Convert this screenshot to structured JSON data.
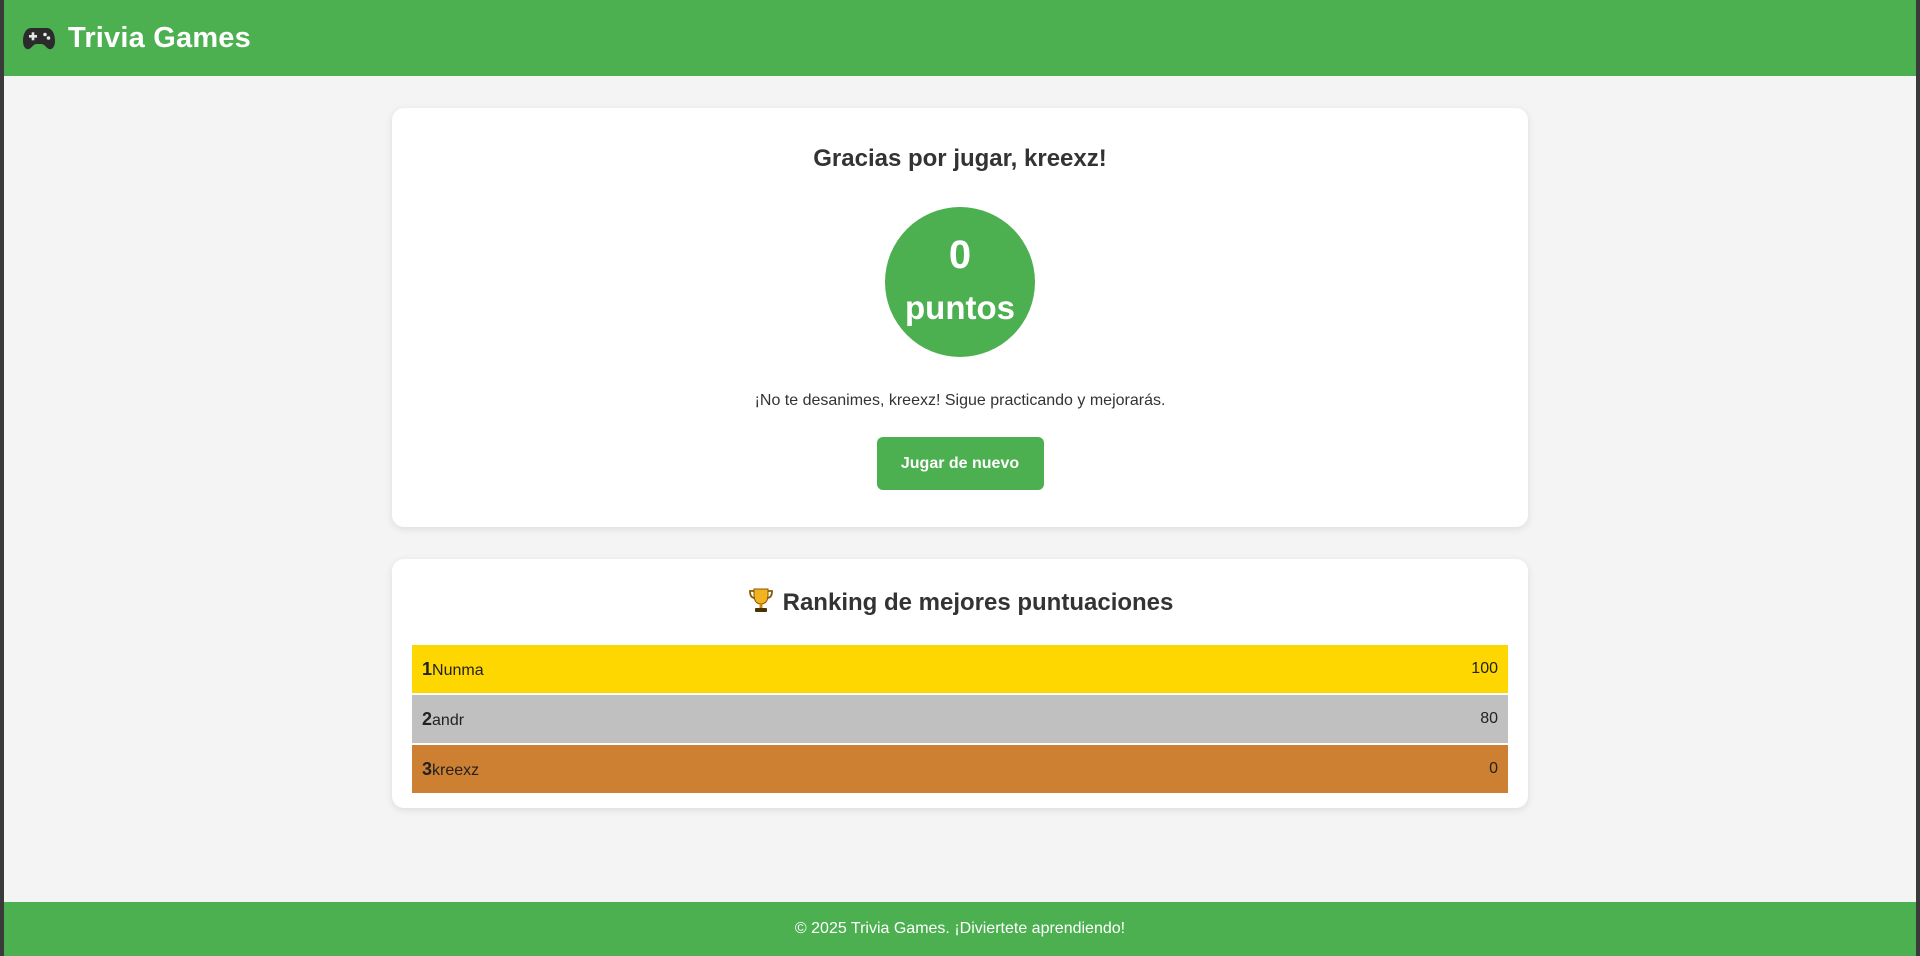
{
  "app": {
    "title": "Trivia Games",
    "logo_icon": "gamepad-icon",
    "accent_color": "#4caf50"
  },
  "result": {
    "title": "Gracias por jugar, kreexz!",
    "score": "0",
    "score_unit": "puntos",
    "message": "¡No te desanimes, kreexz! Sigue practicando y mejorarás.",
    "play_again_label": "Jugar de nuevo"
  },
  "ranking": {
    "icon": "trophy-icon",
    "title": "Ranking de mejores puntuaciones",
    "rows": [
      {
        "rank": "1",
        "name": "Nunma",
        "score": "100",
        "color": "#ffd700"
      },
      {
        "rank": "2",
        "name": "andr",
        "score": "80",
        "color": "#c0c0c0"
      },
      {
        "rank": "3",
        "name": "kreexz",
        "score": "0",
        "color": "#cd7f32"
      }
    ]
  },
  "footer": {
    "text": "© 2025 Trivia Games. ¡Diviertete aprendiendo!"
  }
}
